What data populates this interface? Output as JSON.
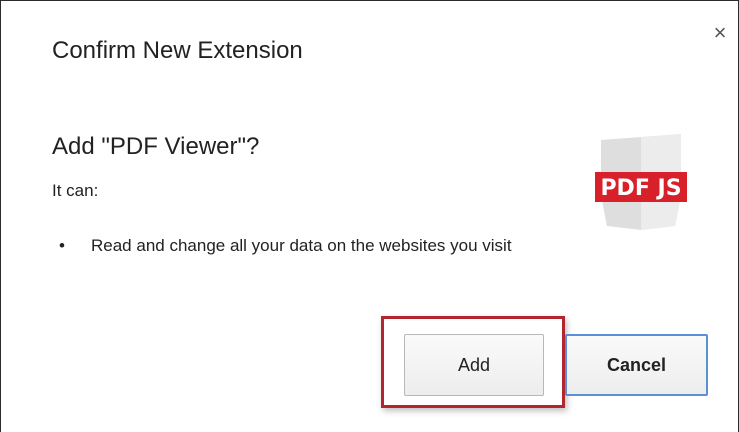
{
  "dialog": {
    "title": "Confirm New Extension",
    "close_label": "×",
    "heading": "Add \"PDF Viewer\"?",
    "it_can_label": "It can:",
    "permissions": [
      "Read and change all your data on the websites you visit"
    ],
    "bullet": "•",
    "icon": {
      "name": "pdf-js-shield-icon",
      "text": "PDF JS",
      "badge_color": "#d8202a",
      "shield_color": "#dedede"
    },
    "buttons": {
      "add_label": "Add",
      "cancel_label": "Cancel"
    },
    "colors": {
      "highlight_border": "#b4262e",
      "focus_border": "#5b8fd6"
    }
  }
}
